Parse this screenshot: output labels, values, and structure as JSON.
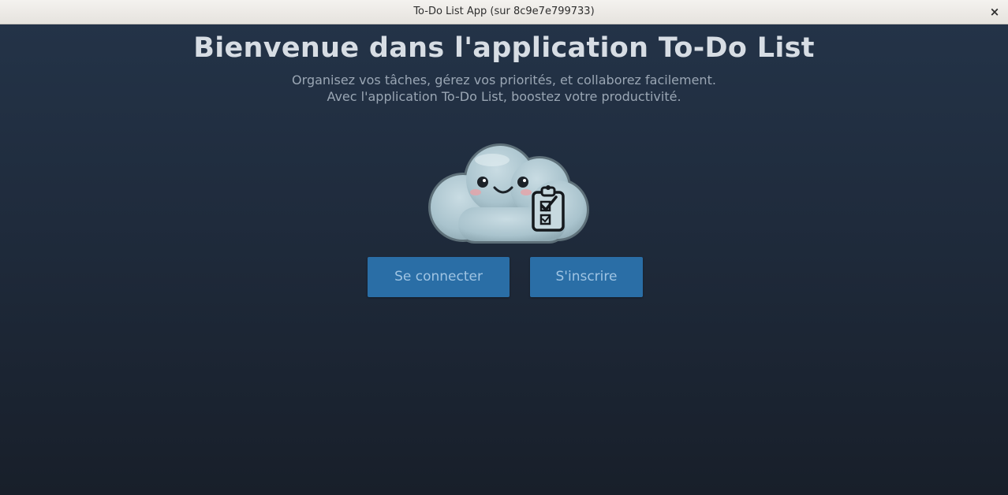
{
  "window": {
    "title": "To-Do List App (sur 8c9e7e799733)",
    "close_symbol": "×"
  },
  "main": {
    "heading": "Bienvenue dans l'application To-Do List",
    "subtitle_line1": "Organisez vos tâches, gérez vos priorités, et collaborez facilement.",
    "subtitle_line2": "Avec l'application To-Do List, boostez votre productivité.",
    "mascot_icon": "cloud-clipboard-mascot-icon"
  },
  "actions": {
    "login_label": "Se connecter",
    "signup_label": "S'inscrire"
  },
  "colors": {
    "background_top": "#243449",
    "background_bottom": "#181f2a",
    "button": "#2a6ea6",
    "button_text": "#9fc4e3",
    "heading": "#d7dde4",
    "subtitle": "#9aa6b4"
  }
}
